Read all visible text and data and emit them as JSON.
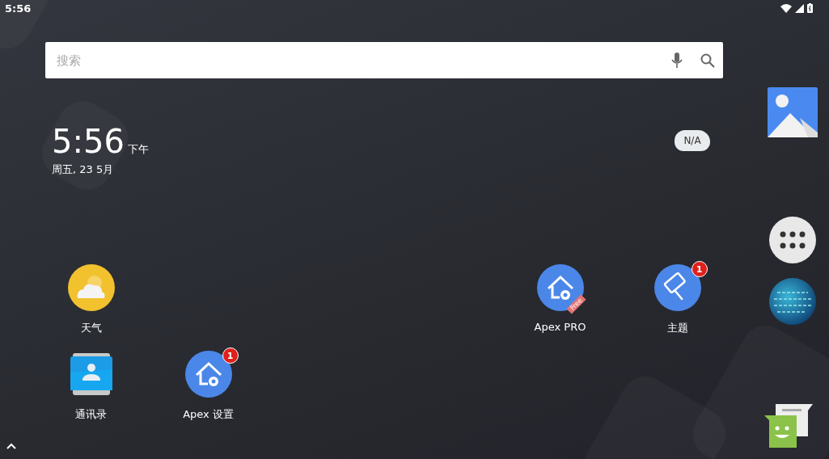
{
  "status_bar": {
    "time": "5:56"
  },
  "search": {
    "placeholder": "搜索"
  },
  "clock": {
    "time": "5:56",
    "ampm": "下午",
    "date": "周五, 23 5月"
  },
  "weather": {
    "reading": "N/A"
  },
  "apps": [
    {
      "kind": "weather",
      "label": "天气"
    },
    {
      "kind": "apex-pro",
      "label": "Apex PRO",
      "ribbon": "Free"
    },
    {
      "kind": "theme",
      "label": "主题",
      "badge": "1"
    },
    {
      "kind": "contacts",
      "label": "通讯录"
    },
    {
      "kind": "apex-settings",
      "label": "Apex 设置",
      "badge": "1"
    }
  ]
}
